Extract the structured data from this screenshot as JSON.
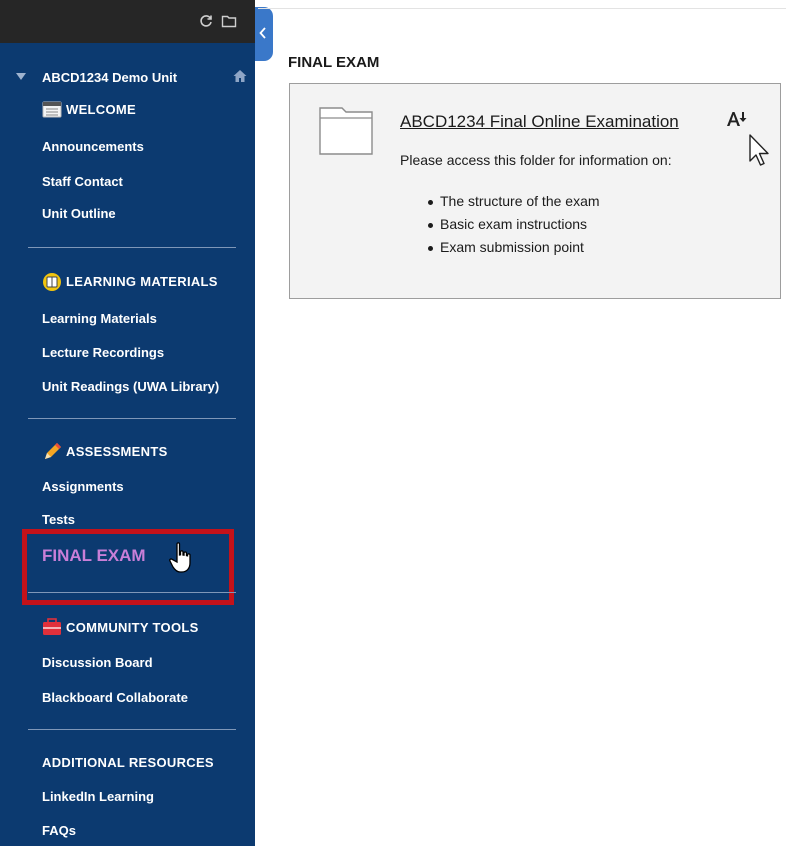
{
  "sidebar": {
    "unit_title": "ABCD1234 Demo Unit",
    "sections": [
      {
        "heading": "WELCOME",
        "icon": "calendar-icon",
        "links": [
          "Announcements",
          "Staff Contact",
          "Unit Outline"
        ]
      },
      {
        "heading": "LEARNING MATERIALS",
        "icon": "book-icon",
        "links": [
          "Learning Materials",
          "Lecture Recordings",
          "Unit Readings (UWA Library)"
        ]
      },
      {
        "heading": "ASSESSMENTS",
        "icon": "pencil-icon",
        "links": [
          "Assignments",
          "Tests"
        ],
        "highlighted_link": "FINAL EXAM"
      },
      {
        "heading": "COMMUNITY TOOLS",
        "icon": "toolbox-icon",
        "links": [
          "Discussion Board",
          "Blackboard Collaborate"
        ]
      },
      {
        "heading": "ADDITIONAL RESOURCES",
        "icon": "",
        "links": [
          "LinkedIn Learning",
          "FAQs"
        ]
      }
    ],
    "colors": {
      "background": "#0c3a70",
      "highlight_border": "#c4121a",
      "highlight_text": "#c97fd8"
    }
  },
  "main": {
    "page_title": "FINAL EXAM",
    "item": {
      "title": "ABCD1234 Final Online Examination",
      "description": "Please access this folder for information on:",
      "bullets": [
        "The structure of the exam",
        "Basic exam instructions",
        "Exam submission point"
      ]
    }
  }
}
